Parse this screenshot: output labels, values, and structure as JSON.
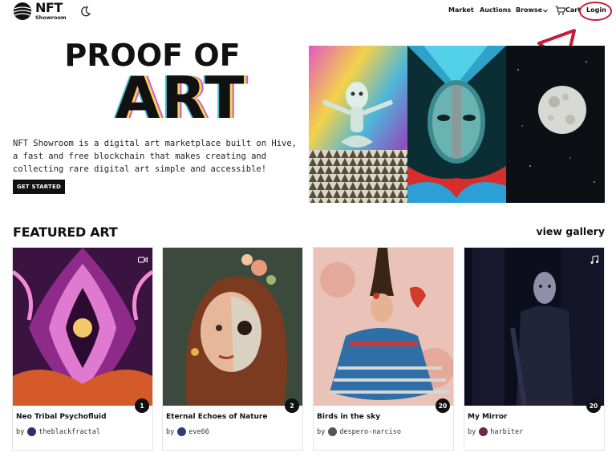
{
  "brand": {
    "name": "NFT",
    "sub": "Showroom"
  },
  "nav": {
    "market": "Market",
    "auctions": "Auctions",
    "browse": "Browse",
    "cart": "Cart",
    "login": "Login"
  },
  "hero": {
    "title_line1": "PROOF OF",
    "title_line2": "ART",
    "description": "NFT Showroom is a digital art marketplace built on Hive, a fast and free blockchain that makes creating and collecting rare digital art simple and accessible!",
    "cta": "GET STARTED"
  },
  "featured": {
    "title": "FEATURED ART",
    "gallery_link": "view gallery",
    "cards": [
      {
        "title": "Neo Tribal Psychofluid",
        "by": "by",
        "author": "theblackfractal",
        "count": "1",
        "media": "video-icon"
      },
      {
        "title": "Eternal Echoes of Nature",
        "by": "by",
        "author": "eve66",
        "count": "2",
        "media": ""
      },
      {
        "title": "Birds in the sky",
        "by": "by",
        "author": "despero-narciso",
        "count": "20",
        "media": ""
      },
      {
        "title": "My Mirror",
        "by": "by",
        "author": "harbiter",
        "count": "20",
        "media": "music-icon"
      }
    ]
  },
  "colors": {
    "accent": "#c51b3b",
    "dark": "#111111"
  }
}
